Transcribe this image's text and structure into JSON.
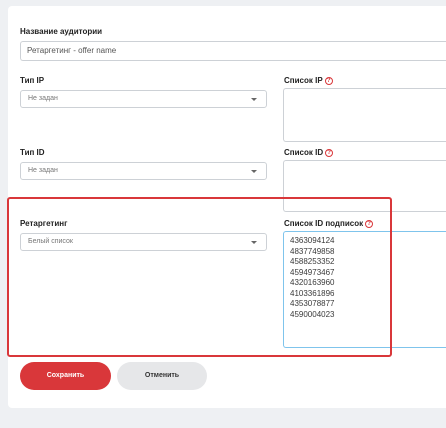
{
  "audience": {
    "name_label": "Название аудитории",
    "name_value": "Ретаргетинг - offer name"
  },
  "ip": {
    "type_label": "Тип IP",
    "type_value": "Не задан",
    "list_label": "Список IP"
  },
  "id": {
    "type_label": "Тип ID",
    "type_value": "Не задан",
    "list_label": "Список ID"
  },
  "retargeting": {
    "label": "Ретаргетинг",
    "value": "Белый список",
    "subs_label": "Список ID подписок",
    "subs_ids": [
      "4363094124",
      "4837749858",
      "4588253352",
      "4594973467",
      "4320163960",
      "4103361896",
      "4353078877",
      "4590004023"
    ]
  },
  "buttons": {
    "save": "Сохранить",
    "cancel": "Отменить"
  },
  "colors": {
    "accent": "#d9373a",
    "focus_border": "#7fc4ec",
    "page_bg": "#eef0f3"
  }
}
